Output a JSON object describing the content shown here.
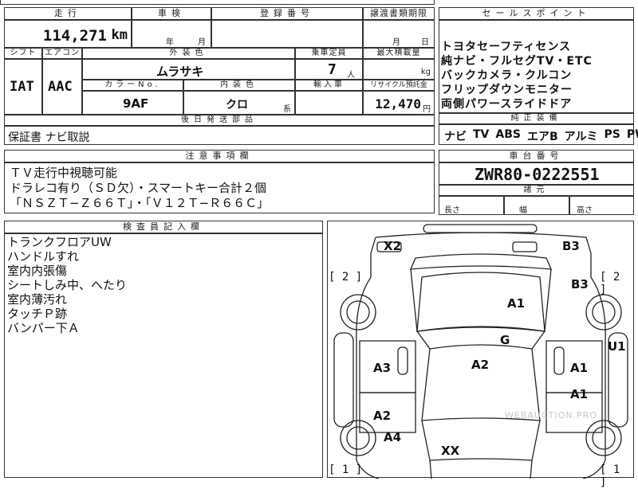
{
  "mileage": {
    "header": "走行",
    "value": "114,271",
    "unit": "km"
  },
  "inspection": {
    "header": "車検",
    "year_label": "年",
    "month_label": "月"
  },
  "registration": {
    "header": "登録番号"
  },
  "transfer": {
    "header": "譲渡書類期限",
    "month_label": "月",
    "day_label": "日"
  },
  "shift": {
    "header": "シフト",
    "value": "IAT"
  },
  "aircon": {
    "header": "エアコン",
    "value": "AAC"
  },
  "exterior_color": {
    "header": "外装色",
    "value": "ムラサキ"
  },
  "capacity": {
    "header": "乗車定員",
    "value": "7",
    "unit": "人"
  },
  "max_load": {
    "header": "最大積載量",
    "unit": "kg"
  },
  "color_no": {
    "header": "カラーNo.",
    "value": "9AF"
  },
  "interior_color": {
    "header": "内装色",
    "value": "クロ",
    "suffix": "系"
  },
  "import": {
    "header": "輸入車"
  },
  "recycle": {
    "header": "リサイクル預託金",
    "value": "12,470",
    "unit": "円"
  },
  "later_parts": {
    "header": "後日発送部品",
    "value": "保証書 ナビ取説"
  },
  "sales_points": {
    "header": "セールスポイント",
    "items": [
      "トヨタセーフティセンス",
      "純ナビ・フルセグTV・ETC",
      "バックカメラ・クルコン",
      "フリップダウンモニター",
      "両側パワースライドドア"
    ]
  },
  "equipment": {
    "header": "純正装備",
    "items": [
      "ナビ",
      "TV",
      "ABS",
      "エアB",
      "アルミ",
      "PS",
      "PW"
    ]
  },
  "notes": {
    "header": "注意事項欄",
    "lines": [
      "ＴＶ走行中視聴可能",
      "ドラレコ有り（ＳＤ欠）・スマートキー合計２個",
      "「ＮＳＺＴ−Ｚ６６Ｔ」・「Ｖ１２Ｔ−Ｒ６６Ｃ」"
    ]
  },
  "chassis": {
    "header": "車台番号",
    "value": "ZWR80-0222551"
  },
  "dimensions": {
    "header": "諸元",
    "length": "長さ",
    "width": "幅",
    "height": "高さ"
  },
  "inspector": {
    "header": "検査員記入欄",
    "lines": [
      "トランクフロアUW",
      "ハンドルすれ",
      "室内内張傷",
      "シートしみ中、へたり",
      "室内薄汚れ",
      "タッチＰ跡",
      "バンパー下Ａ"
    ]
  },
  "diagram": {
    "marks": {
      "rear_left": "X2",
      "rear_right": "B3",
      "right_rear_door": "B3",
      "roof": "A1",
      "right_panel": "U1",
      "glass": "G",
      "left_front_door": "A3",
      "center": "A2",
      "right_front_door": "A1",
      "right_front_fender": "A1",
      "left_front_fender": "A2",
      "left_front_corner": "A4",
      "front": "XX"
    },
    "brackets": {
      "left_rear": "[ 2 ]",
      "right_rear": "[ 2 ]",
      "left_front": "[ 1 ]",
      "right_front": "[ 1 ]"
    },
    "watermark": "WEBAUCTION.PRO"
  }
}
